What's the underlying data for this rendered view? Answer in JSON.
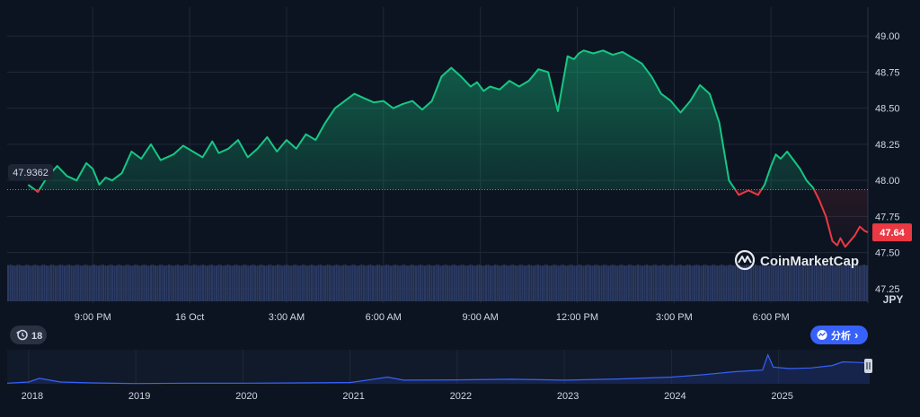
{
  "chart_data": {
    "type": "area",
    "title": "",
    "xlabel": "",
    "ylabel": "",
    "currency_label": "JPY",
    "ylim": [
      47.15,
      49.2
    ],
    "y_ticks": [
      "49.00",
      "48.75",
      "48.50",
      "48.25",
      "48.00",
      "47.75",
      "47.50",
      "47.25"
    ],
    "y_tick_values": [
      49.0,
      48.75,
      48.5,
      48.25,
      48.0,
      47.75,
      47.5,
      47.25
    ],
    "x_tick_labels": [
      "9:00 PM",
      "16 Oct",
      "3:00 AM",
      "6:00 AM",
      "9:00 AM",
      "12:00 PM",
      "3:00 PM",
      "6:00 PM"
    ],
    "x_tick_hours": [
      2,
      5,
      8,
      11,
      14,
      17,
      20,
      23
    ],
    "baseline_value": 47.9362,
    "baseline_label": "47.9362",
    "current_price": 47.64,
    "current_label": "47.64",
    "series": [
      {
        "hours": [
          0,
          0.3,
          0.55,
          0.7,
          0.9,
          1.2,
          1.5,
          1.8,
          2.0,
          2.2,
          2.4,
          2.6,
          2.9,
          3.2,
          3.5,
          3.8,
          4.1,
          4.5,
          4.8,
          5.1,
          5.4,
          5.7,
          5.9,
          6.2,
          6.5,
          6.8,
          7.1,
          7.4,
          7.7,
          8.0,
          8.3,
          8.6,
          8.9,
          9.2,
          9.5,
          9.8,
          10.1,
          10.4,
          10.7,
          11.0,
          11.3,
          11.6,
          11.9,
          12.2,
          12.5,
          12.8,
          13.1,
          13.4,
          13.7,
          13.9,
          14.1,
          14.3,
          14.6,
          14.9,
          15.2,
          15.5,
          15.8,
          16.1,
          16.4,
          16.7,
          16.9,
          17.05,
          17.2,
          17.5,
          17.8,
          18.1,
          18.4,
          18.7,
          19.0,
          19.3,
          19.6,
          19.9,
          20.2,
          20.5,
          20.8,
          21.1,
          21.4,
          21.7,
          22.0,
          22.3,
          22.6,
          22.8,
          23.0,
          23.15,
          23.3,
          23.5,
          23.7,
          23.9,
          24.1,
          24.3,
          24.5,
          24.7,
          24.9,
          25.05,
          25.15,
          25.3,
          25.45,
          25.6,
          25.75,
          25.9,
          26.0
        ],
        "values": [
          47.97,
          47.92,
          48.01,
          48.05,
          48.1,
          48.03,
          48.0,
          48.12,
          48.08,
          47.97,
          48.02,
          48.0,
          48.05,
          48.2,
          48.15,
          48.25,
          48.14,
          48.18,
          48.24,
          48.2,
          48.16,
          48.27,
          48.19,
          48.22,
          48.28,
          48.16,
          48.22,
          48.3,
          48.2,
          48.28,
          48.22,
          48.32,
          48.28,
          48.4,
          48.5,
          48.55,
          48.6,
          48.57,
          48.54,
          48.55,
          48.5,
          48.53,
          48.55,
          48.49,
          48.55,
          48.72,
          48.78,
          48.72,
          48.65,
          48.68,
          48.62,
          48.65,
          48.63,
          48.69,
          48.65,
          48.69,
          48.77,
          48.75,
          48.48,
          48.86,
          48.84,
          48.88,
          48.9,
          48.88,
          48.9,
          48.87,
          48.89,
          48.85,
          48.81,
          48.72,
          48.6,
          48.55,
          48.47,
          48.55,
          48.66,
          48.6,
          48.4,
          48.0,
          47.9,
          47.93,
          47.9,
          47.97,
          48.1,
          48.18,
          48.15,
          48.2,
          48.14,
          48.08,
          48.0,
          47.95,
          47.86,
          47.75,
          47.58,
          47.55,
          47.6,
          47.54,
          47.58,
          47.62,
          47.68,
          47.65,
          47.64
        ],
        "color_up": "#16c784",
        "color_down": "#ea3943"
      }
    ],
    "volume_bars": 380,
    "volume_level": 0.93,
    "overview": {
      "year_labels": [
        "2018",
        "2019",
        "2020",
        "2021",
        "2022",
        "2023",
        "2024",
        "2025"
      ],
      "years": [
        2018,
        2019,
        2020,
        2021,
        2022,
        2023,
        2024,
        2025
      ],
      "x_range": [
        2017.8,
        2025.85
      ],
      "ylim": [
        0,
        1
      ],
      "x": [
        2017.8,
        2018.0,
        2018.1,
        2018.3,
        2018.6,
        2019.0,
        2019.5,
        2020.0,
        2020.5,
        2021.0,
        2021.2,
        2021.35,
        2021.5,
        2022.0,
        2022.5,
        2023.0,
        2023.5,
        2024.0,
        2024.3,
        2024.6,
        2024.85,
        2024.9,
        2024.95,
        2025.1,
        2025.3,
        2025.5,
        2025.6,
        2025.75,
        2025.85
      ],
      "values": [
        0.02,
        0.06,
        0.18,
        0.06,
        0.03,
        0.01,
        0.02,
        0.02,
        0.03,
        0.04,
        0.14,
        0.22,
        0.12,
        0.13,
        0.15,
        0.12,
        0.16,
        0.22,
        0.3,
        0.4,
        0.45,
        0.95,
        0.55,
        0.5,
        0.52,
        0.6,
        0.72,
        0.7,
        0.68
      ]
    }
  },
  "brand": {
    "name": "CoinMarketCap"
  },
  "controls": {
    "history_badge": "18",
    "analysis_button": "分析",
    "analysis_chevron": "›"
  },
  "colors": {
    "background": "#0d1421",
    "grid": "#222b3a",
    "accent": "#3861fb",
    "volume": "#2b3a62"
  }
}
